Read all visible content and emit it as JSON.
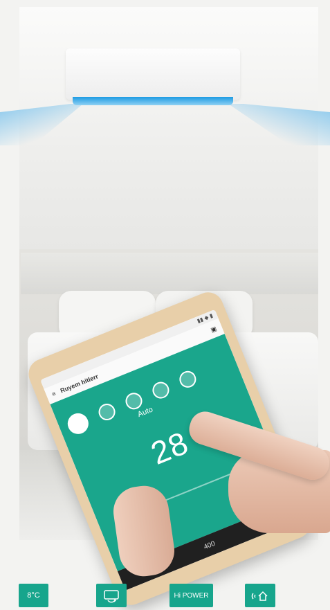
{
  "tablet_app": {
    "title": "Ruyem hitlerr",
    "mode_label": "Auto",
    "temperature": "28",
    "fan_value": "400"
  },
  "features": {
    "item1": {
      "label": "8°C",
      "icon": "8-degree-heating-icon"
    },
    "item2": {
      "icon": "auto-restart-icon"
    },
    "item3": {
      "label": "Hi POWER"
    },
    "item4": {
      "icon": "wifi-home-icon"
    }
  },
  "colors": {
    "accent": "#17a58c",
    "ac_light": "#1d9be3"
  }
}
